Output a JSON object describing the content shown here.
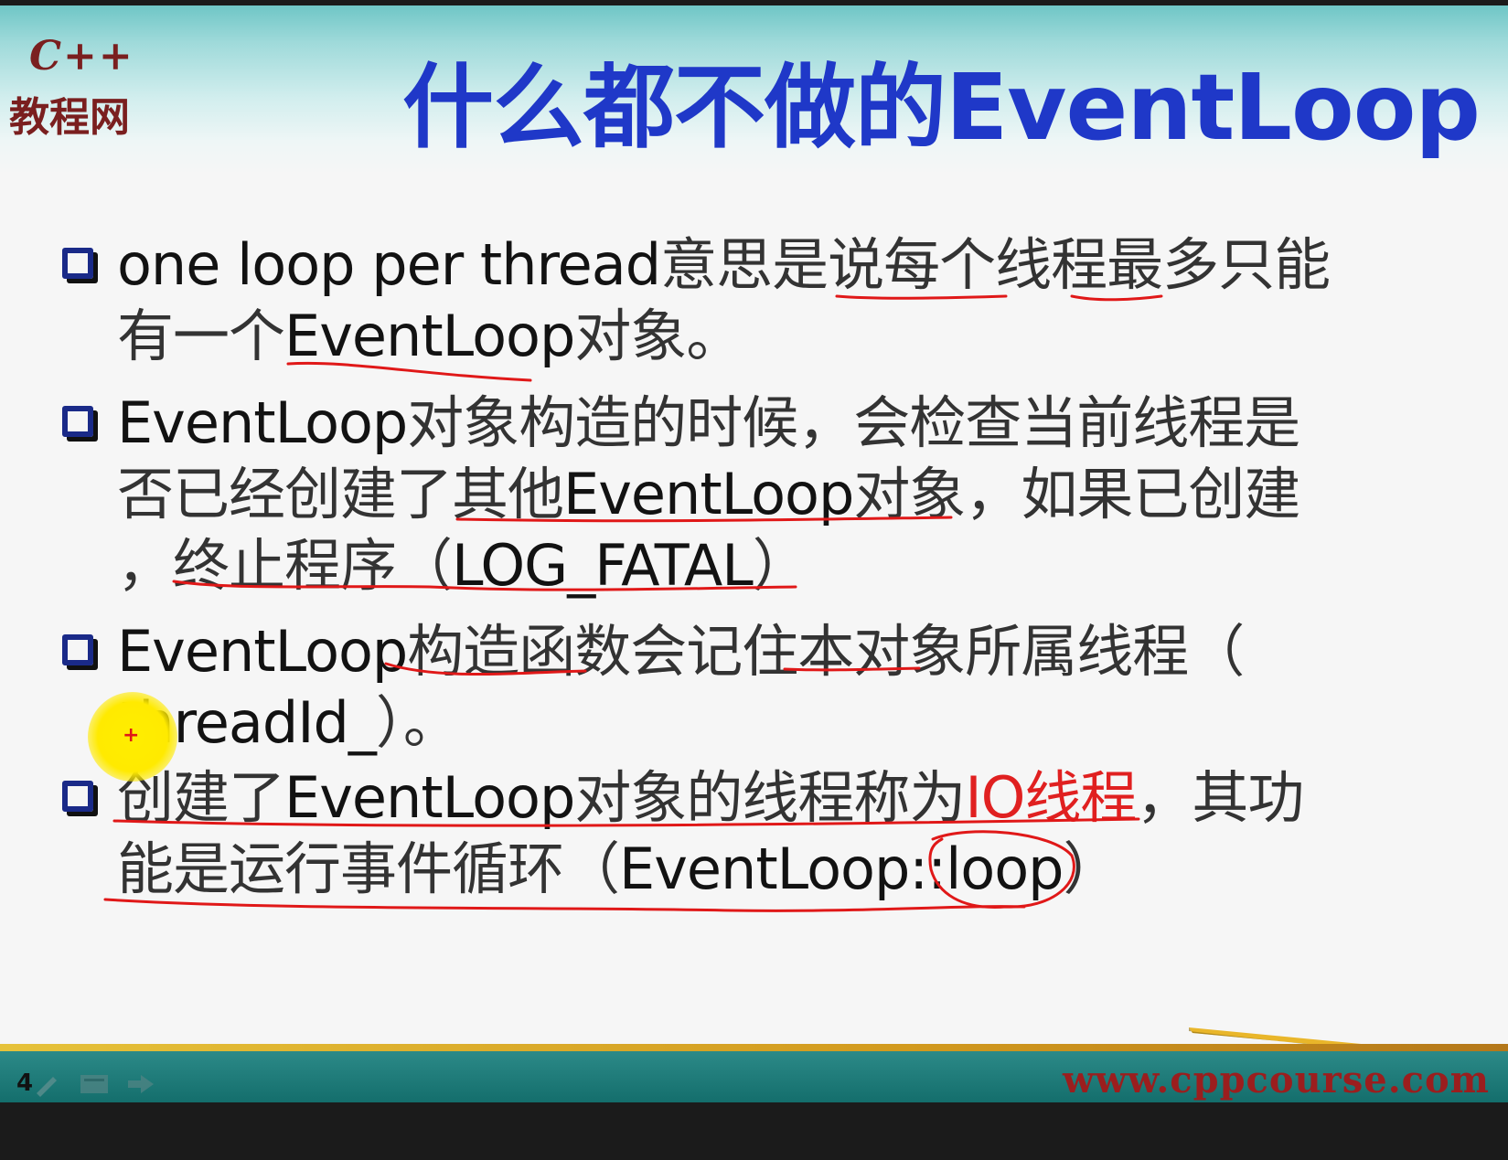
{
  "slide": {
    "logo_top": "C++",
    "logo_bottom": "教程网",
    "title": "什么都不做的EventLoop",
    "bullets": [
      {
        "lines": [
          [
            {
              "t": "one loop per thread",
              "zh": false
            },
            {
              "t": "意思是说每个线程最多只能",
              "zh": true
            }
          ],
          [
            {
              "t": "有一个",
              "zh": true
            },
            {
              "t": "EventLoop",
              "zh": false
            },
            {
              "t": "对象。",
              "zh": true
            }
          ]
        ]
      },
      {
        "lines": [
          [
            {
              "t": "EventLoop",
              "zh": false
            },
            {
              "t": "对象构造的时候，会检查当前线程是",
              "zh": true
            }
          ],
          [
            {
              "t": "否已经创建了其他",
              "zh": true
            },
            {
              "t": "EventLoop",
              "zh": false
            },
            {
              "t": "对象，如果已创建",
              "zh": true
            }
          ],
          [
            {
              "t": "，终止程序（",
              "zh": true
            },
            {
              "t": "LOG_FATAL",
              "zh": false
            },
            {
              "t": "）",
              "zh": true
            }
          ]
        ]
      },
      {
        "lines": [
          [
            {
              "t": "EventLoop",
              "zh": false
            },
            {
              "t": "构造函数会记住本对象所属线程（",
              "zh": true
            }
          ],
          [
            {
              "t": "threadId_",
              "zh": false
            },
            {
              "t": "）。",
              "zh": true
            }
          ]
        ]
      },
      {
        "lines": [
          [
            {
              "t": "创建了",
              "zh": true
            },
            {
              "t": "EventLoop",
              "zh": false
            },
            {
              "t": "对象的线程称为",
              "zh": true
            },
            {
              "t": "IO线程",
              "zh": false,
              "highlight": true
            },
            {
              "t": "，其功",
              "zh": true
            }
          ],
          [
            {
              "t": "能是运行事件循环（",
              "zh": true
            },
            {
              "t": "EventLoop::loop",
              "zh": false
            },
            {
              "t": "）",
              "zh": true
            }
          ]
        ]
      }
    ]
  },
  "footer": {
    "page_number": "4",
    "website": "www.cppcourse.com"
  },
  "colors": {
    "title": "#1f38c8",
    "logo": "#7a1f1f",
    "highlight": "#e02020",
    "annotation": "#e01818",
    "footer": "#146e6c"
  }
}
